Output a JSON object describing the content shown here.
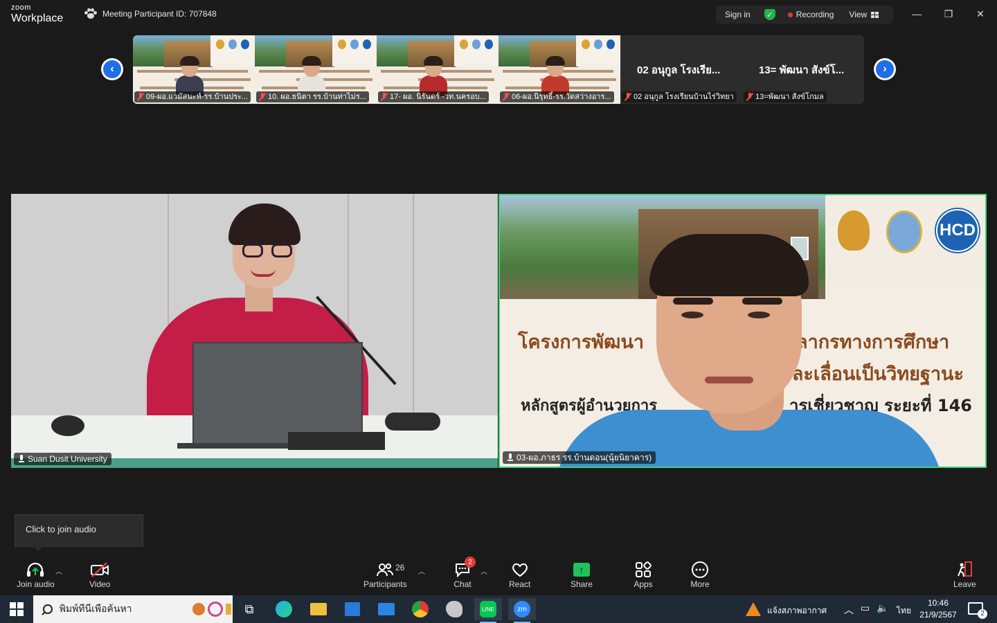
{
  "app": {
    "brand_small": "zoom",
    "brand_big": "Workplace",
    "meeting_id_label": "Meeting Participant ID: 707848"
  },
  "titlebar": {
    "sign_in": "Sign in",
    "recording": "Recording",
    "view": "View"
  },
  "gallery": {
    "thumbnails": [
      {
        "name": "09-ผอ.แวมัสนะห์-รร.บ้านประ..."
      },
      {
        "name": "10. ผอ.ธนิตา รร.บ้านท่าไม่ร..."
      },
      {
        "name": "17- ผอ. นิรันดร์ -วท.นครอบ..."
      },
      {
        "name": "06-ผอ.นิรุทธิ์-รร.วัดสว่างอาร..."
      }
    ],
    "text_tiles": [
      {
        "display": "02 อนุกูล โรงเรีย...",
        "name": "02 อนุกูล โรงเรียนบ้านไร่วิทยา"
      },
      {
        "display": "13= พัฒนา สังข์โ...",
        "name": "13=พัฒนา สังข์โกมล"
      }
    ]
  },
  "videos": {
    "left_name": "Suan Dusit University",
    "right_name": "03-ผอ.ภาธร รร.บ้านดอน(นุ้ยนิยาคาร)",
    "slide_line1_left": "โครงการพัฒนา",
    "slide_line1_right": "คลากรทางการศึกษา",
    "slide_line2": "นและเลื่อนเป็นวิทยฐานะ",
    "slide_line3_left": "หลักสูตรผู้อำนวยการ",
    "slide_line3_right": "ารเชี่ยวชาญ ระยะที่ 146",
    "logo_text": "HCD"
  },
  "tooltip": "Click to join audio",
  "toolbar": {
    "join_audio": "Join audio",
    "video": "Video",
    "participants": "Participants",
    "participants_count": "26",
    "chat": "Chat",
    "chat_badge": "2",
    "react": "React",
    "share": "Share",
    "apps": "Apps",
    "more": "More",
    "leave": "Leave"
  },
  "taskbar": {
    "search_placeholder": "พิมพ์ที่นี่เพื่อค้นหา",
    "weather": "แจ้งสภาพอากาศ",
    "language": "ไทย",
    "time": "10:46",
    "date": "21/9/2567",
    "notifications": "2"
  },
  "colors": {
    "active_speaker_border": "#3fd17a",
    "recording_dot": "#e03a3a",
    "share_green": "#22c15e",
    "accent_blue": "#1e6fe8",
    "badge_red": "#e43c3c"
  }
}
